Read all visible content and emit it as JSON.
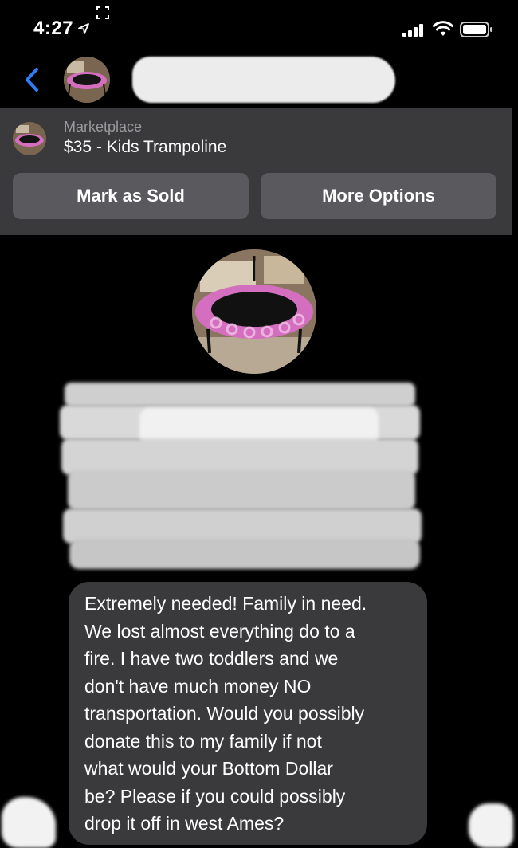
{
  "status_bar": {
    "time": "4:27",
    "icons": [
      "location-arrow-icon",
      "screen-record-icon",
      "signal-icon",
      "wifi-icon",
      "battery-icon"
    ]
  },
  "header": {
    "icons": [
      "back-chevron-icon"
    ],
    "contact_name_redacted": true
  },
  "marketplace": {
    "label": "Marketplace",
    "title": "$35 - Kids Trampoline",
    "mark_sold": "Mark as Sold",
    "more_options": "More Options"
  },
  "message": {
    "text": "Extremely needed! Family in need.\nWe lost almost everything do to a\nfire. I have two toddlers and we\ndon't have much money NO\ntransportation. Would you possibly\ndonate this to my family if not\nwhat would your Bottom Dollar\nbe? Please if you could possibly\ndrop it off in west Ames?"
  },
  "colors": {
    "background": "#000000",
    "panel": "#3a3a3c",
    "button": "#5a5a5e",
    "accent": "#2f7cf6",
    "trampoline_pink": "#d46fc0"
  }
}
